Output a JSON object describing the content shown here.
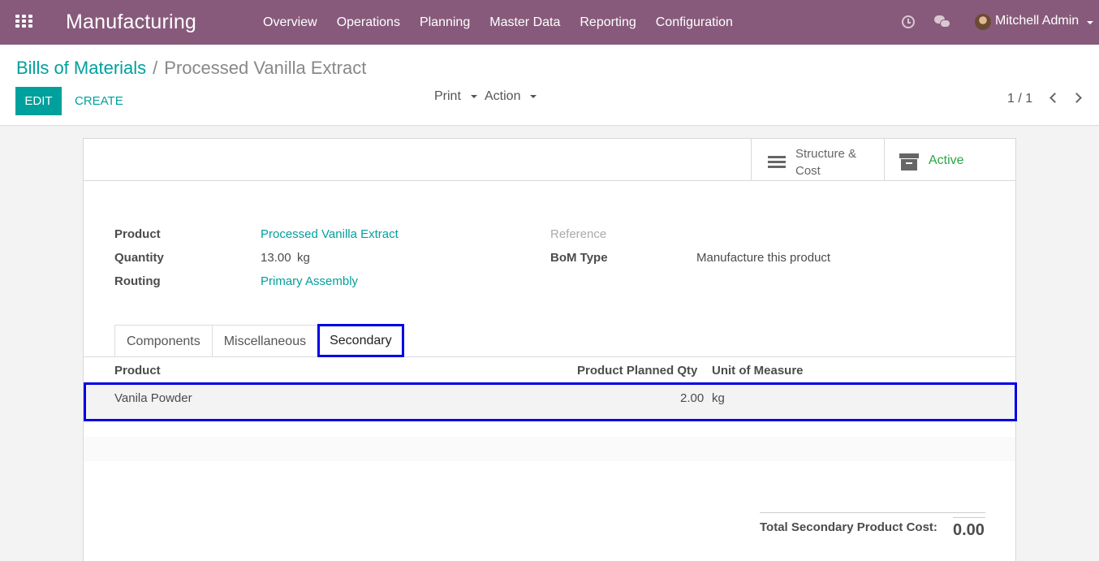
{
  "navbar": {
    "brand": "Manufacturing",
    "menu": [
      "Overview",
      "Operations",
      "Planning",
      "Master Data",
      "Reporting",
      "Configuration"
    ],
    "user_name": "Mitchell Admin",
    "accent": "#875a7b"
  },
  "control_panel": {
    "breadcrumb_parent": "Bills of Materials",
    "breadcrumb_sep": "/",
    "breadcrumb_current": "Processed Vanilla Extract",
    "edit_label": "EDIT",
    "create_label": "CREATE",
    "print_label": "Print",
    "action_label": "Action",
    "pager": "1 / 1"
  },
  "form": {
    "smart_buttons": {
      "structure_line1": "Structure &",
      "structure_line2": "Cost",
      "active": "Active"
    },
    "fields": {
      "product_label": "Product",
      "product_value": "Processed Vanilla Extract",
      "quantity_label": "Quantity",
      "quantity_value": "13.00",
      "quantity_uom": "kg",
      "routing_label": "Routing",
      "routing_value": "Primary Assembly",
      "reference_label": "Reference",
      "bom_type_label": "BoM Type",
      "bom_type_value": "Manufacture this product"
    },
    "tabs": [
      "Components",
      "Miscellaneous",
      "Secondary"
    ],
    "table": {
      "headers": [
        "Product",
        "Product Planned Qty",
        "Unit of Measure"
      ],
      "rows": [
        {
          "product": "Vanila Powder",
          "qty": "2.00",
          "uom": "kg"
        }
      ]
    },
    "total_label": "Total Secondary Product Cost:",
    "total_value": "0.00"
  },
  "colors": {
    "link": "#00a09d",
    "active_green": "#28a745",
    "highlight_border": "#0000e6"
  }
}
